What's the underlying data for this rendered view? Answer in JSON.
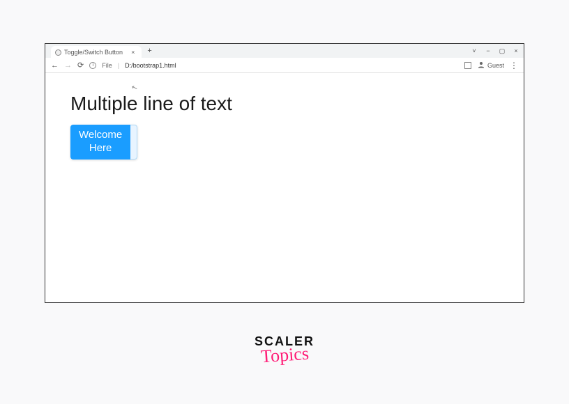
{
  "tab": {
    "title": "Toggle/Switch Button",
    "close": "×"
  },
  "window": {
    "minimize": "−",
    "restore": "▢",
    "close": "×"
  },
  "toolbar": {
    "file_label": "File",
    "url": "D:/bootstrap1.html",
    "profile_label": "Guest"
  },
  "page": {
    "heading": "Multiple line of text",
    "button_line1": "Welcome",
    "button_line2": "Here"
  },
  "watermark": {
    "line1": "SCALER",
    "line2": "Topics"
  }
}
